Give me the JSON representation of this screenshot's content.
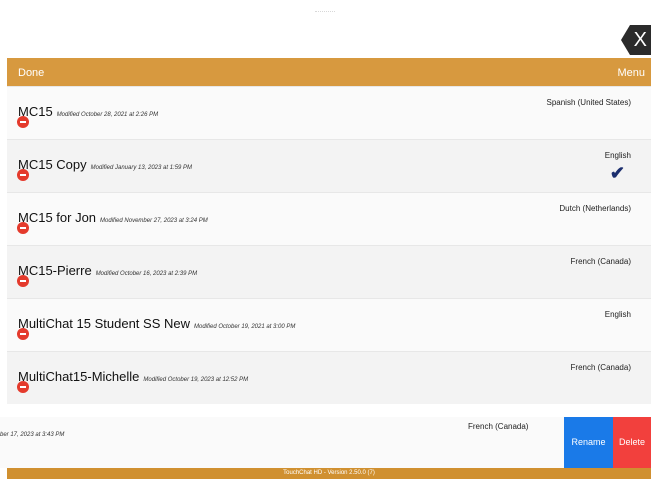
{
  "close": {
    "label": "X"
  },
  "topbar": {
    "done_label": "Done",
    "menu_label": "Menu"
  },
  "vocabularies": [
    {
      "name": "MC15",
      "modified": "Modified October 28, 2021 at 2:26 PM",
      "language": "Spanish (United States)",
      "selected": false
    },
    {
      "name": "MC15 Copy",
      "modified": "Modified January 13, 2023 at 1:59 PM",
      "language": "English",
      "selected": true
    },
    {
      "name": "MC15 for Jon",
      "modified": "Modified November 27, 2023 at 3:24 PM",
      "language": "Dutch (Netherlands)",
      "selected": false
    },
    {
      "name": "MC15-Pierre",
      "modified": "Modified October 16, 2023 at 2:39 PM",
      "language": "French (Canada)",
      "selected": false
    },
    {
      "name": "MultiChat 15 Student SS New",
      "modified": "Modified October 19, 2021 at 3:00 PM",
      "language": "English",
      "selected": false
    },
    {
      "name": "MultiChat15-Michelle",
      "modified": "Modified October 19, 2023 at 12:52 PM",
      "language": "French (Canada)",
      "selected": false
    }
  ],
  "swiped_row": {
    "modified_fragment": "ber 17, 2023 at 3:43 PM",
    "language": "French (Canada)",
    "rename_label": "Rename",
    "delete_label": "Delete"
  },
  "check_glyph": "✔",
  "footer": {
    "version": "TouchChat HD - Version 2.50.0 (7)"
  }
}
